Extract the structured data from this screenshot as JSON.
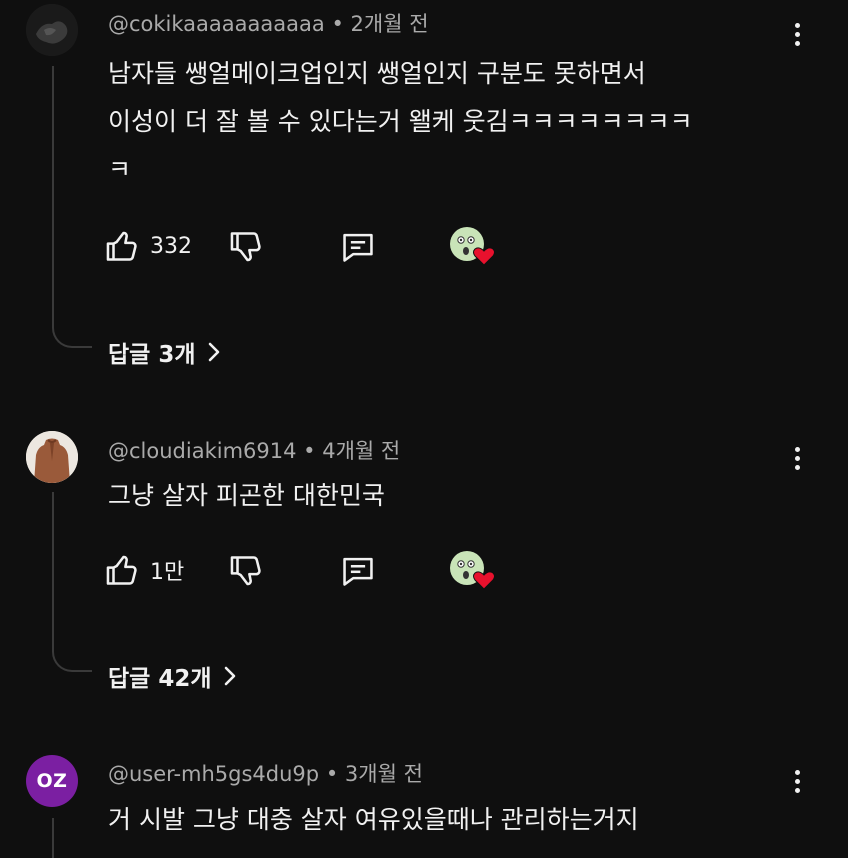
{
  "comments": [
    {
      "username": "@cokikaaaaaaaaaaa",
      "time": "2개월 전",
      "lines": [
        "남자들 쌩얼메이크업인지 쌩얼인지 구분도 못하면서",
        "이성이 더 잘 볼 수 있다는거 왤케 웃김ㅋㅋㅋㅋㅋㅋㅋㅋ",
        "ㅋ"
      ],
      "likes": "332",
      "replies_label": "답글 3개"
    },
    {
      "username": "@cloudiakim6914",
      "time": "4개월 전",
      "lines": [
        "그냥 살자 피곤한 대한민국"
      ],
      "likes": "1만",
      "replies_label": "답글 42개"
    },
    {
      "username": "@user-mh5gs4du9p",
      "time": "3개월 전",
      "avatar_initials": "OZ",
      "lines": [
        "거 시발 그냥 대충 살자 여유있을때나 관리하는거지"
      ]
    }
  ],
  "meta_separator": "•",
  "icons": {
    "like": "thumbs-up-icon",
    "dislike": "thumbs-down-icon",
    "reply": "comment-icon",
    "creator_heart": "creator-heart-icon",
    "more": "more-vertical-icon",
    "chevron": "chevron-right-icon"
  },
  "colors": {
    "background": "#0f0f0f",
    "text": "#f1f1f1",
    "secondary_text": "#aaaaaa",
    "heart": "#e8112d",
    "avatar_oz": "#7b1fa2"
  }
}
